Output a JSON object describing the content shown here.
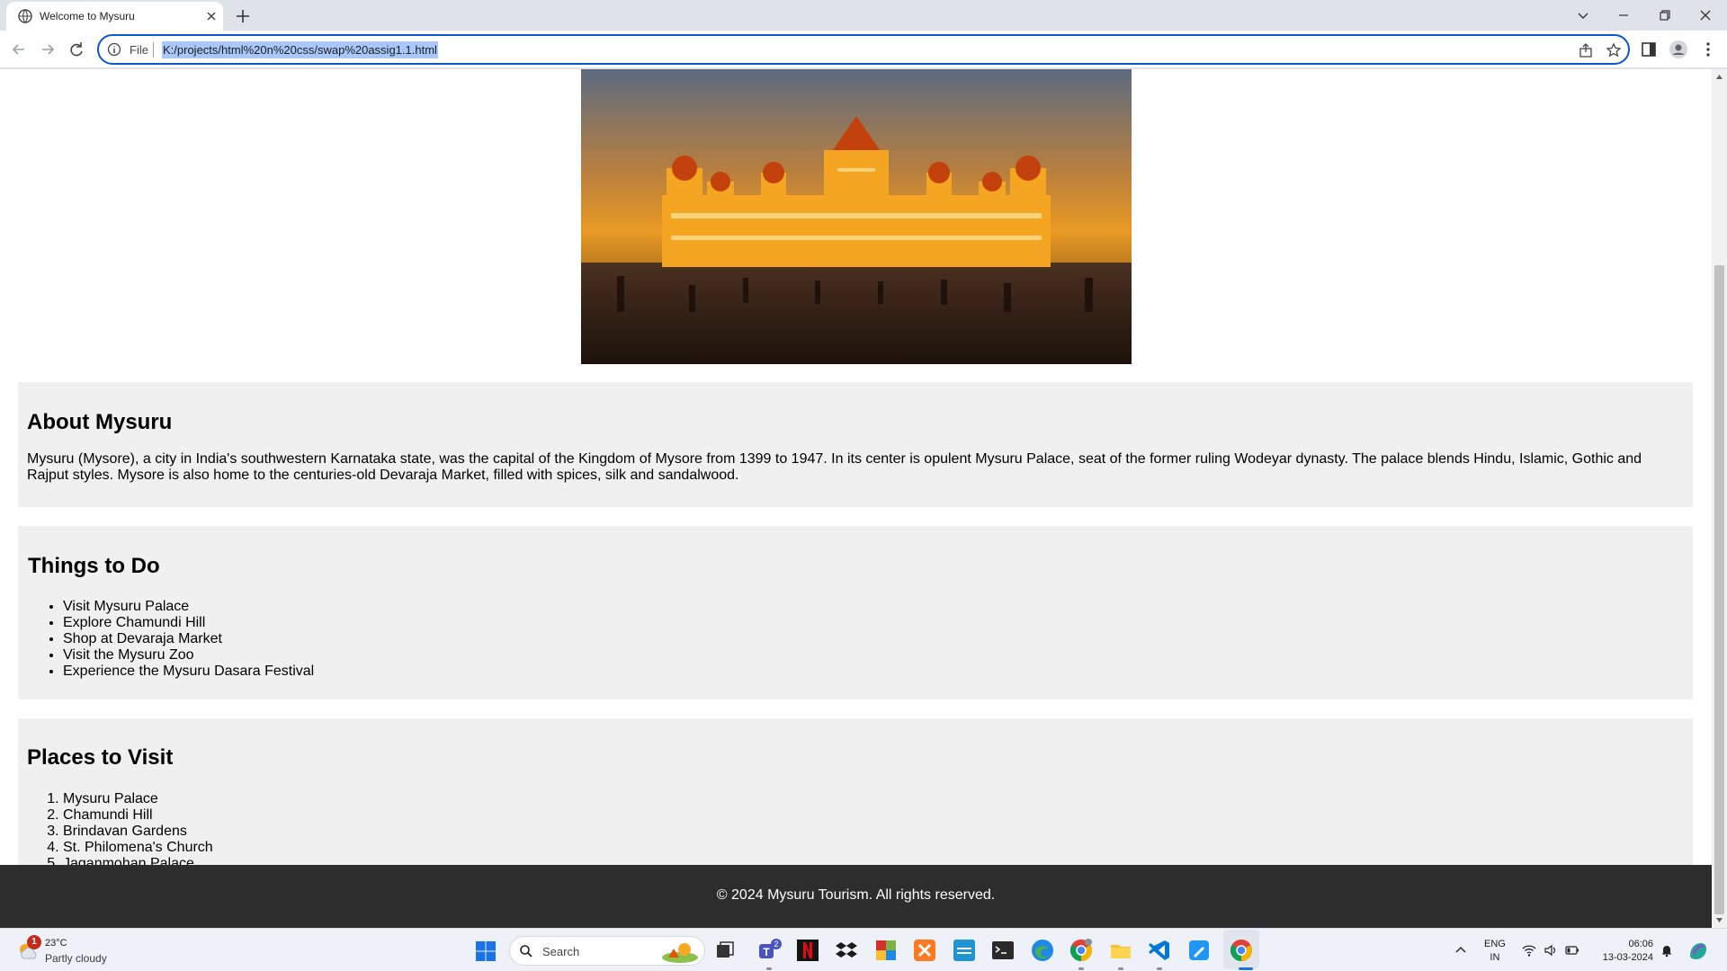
{
  "browser": {
    "tab_title": "Welcome to Mysuru",
    "scheme_label": "File",
    "url": "K:/projects/html%20n%20css/swap%20assig1.1.html"
  },
  "page": {
    "about": {
      "heading": "About Mysuru",
      "text": "Mysuru (Mysore), a city in India's southwestern Karnataka state, was the capital of the Kingdom of Mysore from 1399 to 1947. In its center is opulent Mysuru Palace, seat of the former ruling Wodeyar dynasty. The palace blends Hindu, Islamic, Gothic and Rajput styles. Mysore is also home to the centuries-old Devaraja Market, filled with spices, silk and sandalwood."
    },
    "things_to_do": {
      "heading": "Things to Do",
      "items": [
        "Visit Mysuru Palace",
        "Explore Chamundi Hill",
        "Shop at Devaraja Market",
        "Visit the Mysuru Zoo",
        "Experience the Mysuru Dasara Festival"
      ]
    },
    "places_to_visit": {
      "heading": "Places to Visit",
      "items": [
        "Mysuru Palace",
        "Chamundi Hill",
        "Brindavan Gardens",
        "St. Philomena's Church",
        "Jaganmohan Palace"
      ]
    },
    "footer": "© 2024 Mysuru Tourism. All rights reserved."
  },
  "taskbar": {
    "weather": {
      "badge": "1",
      "temp": "23°C",
      "condition": "Partly cloudy"
    },
    "search_label": "Search",
    "teams_badge": "2",
    "lang_top": "ENG",
    "lang_bottom": "IN",
    "time": "06:06",
    "date": "13-03-2024"
  },
  "colors": {
    "accent": "#0b57d0",
    "section_bg": "#f0f0f0",
    "footer_bg": "#2d2d2d"
  }
}
